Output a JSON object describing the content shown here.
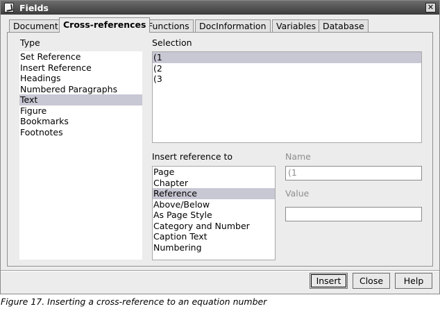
{
  "window": {
    "title": "Fields"
  },
  "tabs": [
    "Document",
    "Cross-references",
    "Functions",
    "DocInformation",
    "Variables",
    "Database"
  ],
  "type_section": {
    "label": "Type",
    "items": [
      "Set Reference",
      "Insert Reference",
      "Headings",
      "Numbered Paragraphs",
      "Text",
      "Figure",
      "Bookmarks",
      "Footnotes"
    ],
    "selected": "Text"
  },
  "selection_section": {
    "label": "Selection",
    "items": [
      "(1",
      "(2",
      "(3"
    ],
    "selected": "(1"
  },
  "insert_reference_section": {
    "label": "Insert reference to",
    "items": [
      "Page",
      "Chapter",
      "Reference",
      "Above/Below",
      "As Page Style",
      "Category and Number",
      "Caption Text",
      "Numbering"
    ],
    "selected": "Reference"
  },
  "name_field": {
    "label": "Name",
    "value": "(1"
  },
  "value_field": {
    "label": "Value",
    "value": ""
  },
  "buttons": {
    "insert": "Insert",
    "close": "Close",
    "help": "Help"
  },
  "caption": "Figure 17. Inserting a cross-reference to an equation number"
}
